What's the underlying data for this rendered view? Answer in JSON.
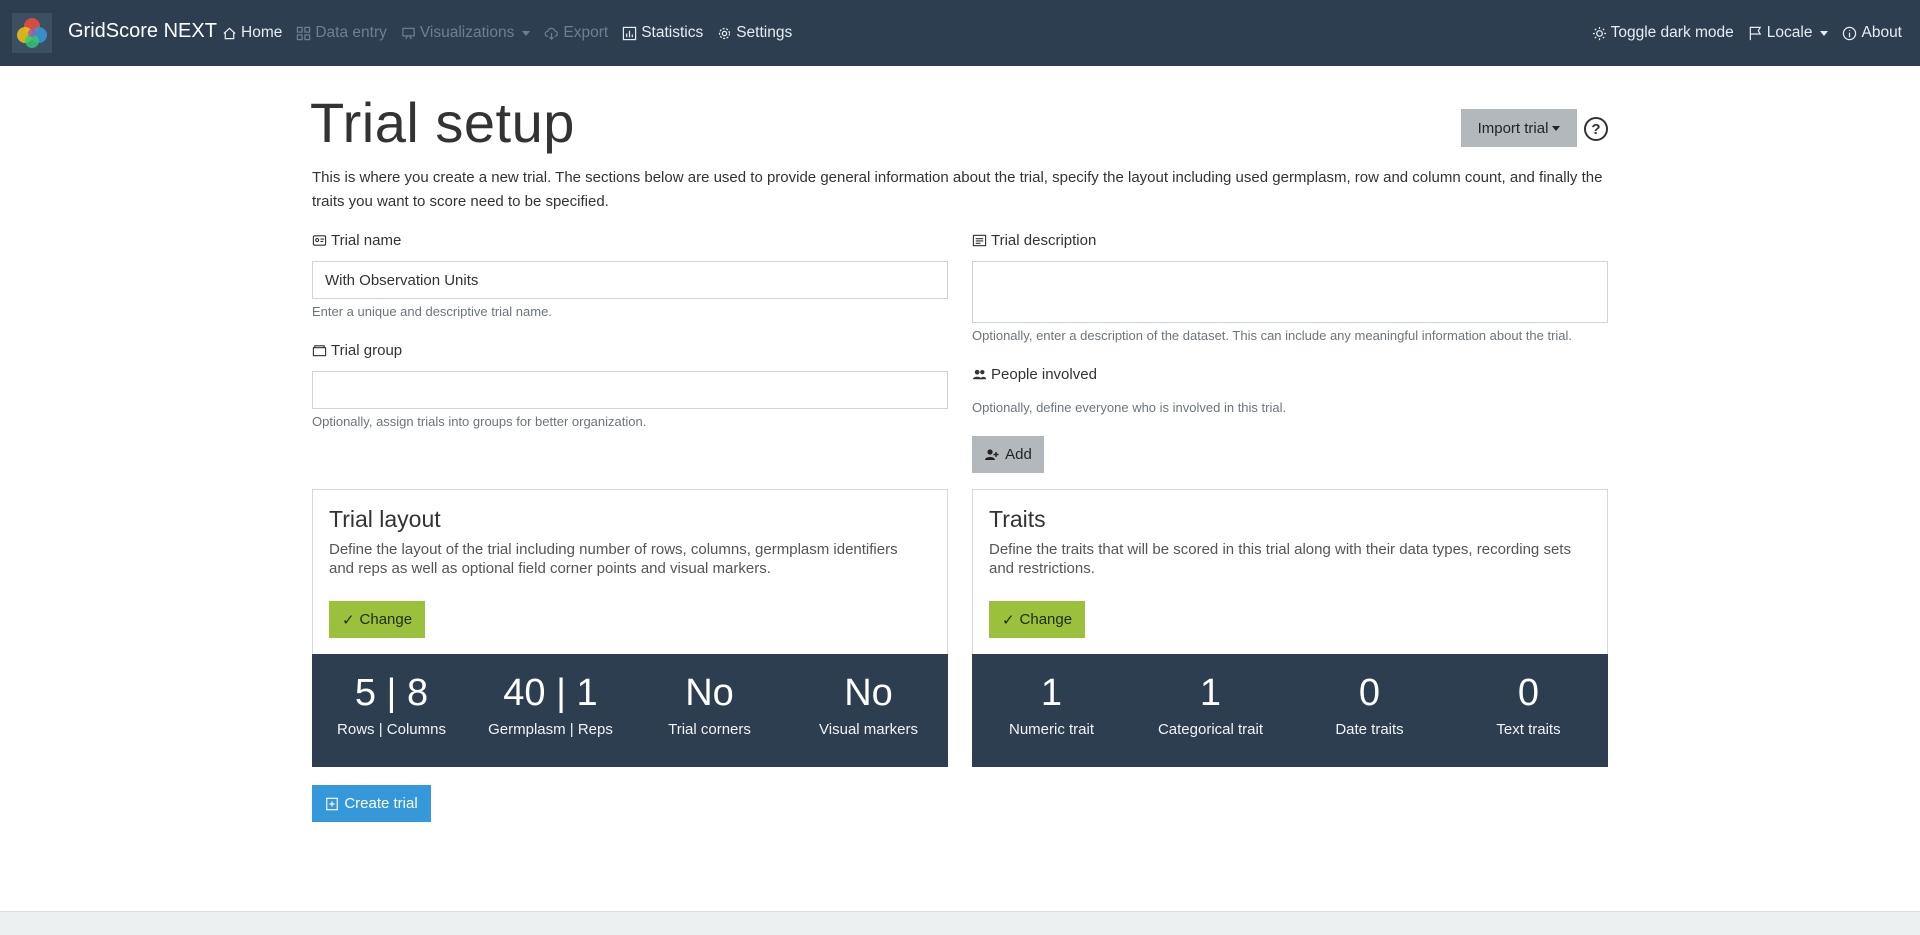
{
  "navbar": {
    "brand": "GridScore NEXT",
    "left_items": [
      {
        "label": "Home",
        "icon": "house-icon",
        "disabled": false
      },
      {
        "label": "Data entry",
        "icon": "grid-icon",
        "disabled": true
      },
      {
        "label": "Visualizations",
        "icon": "easel-icon",
        "disabled": true,
        "dropdown": true
      },
      {
        "label": "Export",
        "icon": "cloud-download-icon",
        "disabled": true
      },
      {
        "label": "Statistics",
        "icon": "chart-icon",
        "disabled": false
      },
      {
        "label": "Settings",
        "icon": "gear-icon",
        "disabled": false
      }
    ],
    "right_items": [
      {
        "label": "Toggle dark mode",
        "icon": "sun-icon"
      },
      {
        "label": "Locale",
        "icon": "flag-icon",
        "dropdown": true
      },
      {
        "label": "About",
        "icon": "info-icon"
      }
    ]
  },
  "page": {
    "title": "Trial setup",
    "import_label": "Import trial",
    "help_symbol": "?",
    "intro": "This is where you create a new trial. The sections below are used to provide general information about the trial, specify the layout including used germplasm, row and column count, and finally the traits you want to score need to be specified."
  },
  "form": {
    "trial_name": {
      "label": "Trial name",
      "value": "With Observation Units",
      "hint": "Enter a unique and descriptive trial name."
    },
    "trial_group": {
      "label": "Trial group",
      "value": "",
      "hint": "Optionally, assign trials into groups for better organization."
    },
    "trial_description": {
      "label": "Trial description",
      "value": "",
      "hint": "Optionally, enter a description of the dataset. This can include any meaningful information about the trial."
    },
    "people": {
      "label": "People involved",
      "hint": "Optionally, define everyone who is involved in this trial.",
      "add_label": "Add"
    }
  },
  "layout_card": {
    "title": "Trial layout",
    "text": "Define the layout of the trial including number of rows, columns, germplasm identifiers and reps as well as optional field corner points and visual markers.",
    "change_label": "Change",
    "stats": [
      {
        "value": "5 | 8",
        "label": "Rows | Columns"
      },
      {
        "value": "40 | 1",
        "label": "Germplasm | Reps"
      },
      {
        "value": "No",
        "label": "Trial corners"
      },
      {
        "value": "No",
        "label": "Visual markers"
      }
    ]
  },
  "traits_card": {
    "title": "Traits",
    "text": "Define the traits that will be scored in this trial along with their data types, recording sets and restrictions.",
    "change_label": "Change",
    "stats": [
      {
        "value": "1",
        "label": "Numeric trait"
      },
      {
        "value": "1",
        "label": "Categorical trait"
      },
      {
        "value": "0",
        "label": "Date traits"
      },
      {
        "value": "0",
        "label": "Text traits"
      }
    ]
  },
  "create_label": "Create trial",
  "colors": {
    "navbar": "#2c3e50",
    "change_button": "#9bc03c",
    "create_button": "#3498db",
    "neutral_button": "#b3b8bc"
  }
}
